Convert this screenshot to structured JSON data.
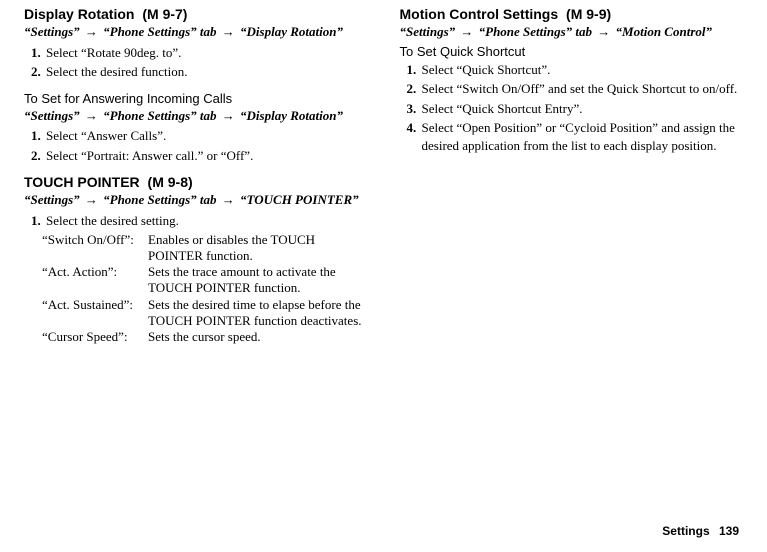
{
  "left": {
    "displayRotation": {
      "title": "Display Rotation",
      "mcode": "(M 9-7)",
      "navA": "“Settings”",
      "navB": "“Phone Settings” tab",
      "navC": "“Display Rotation”",
      "steps": [
        "Select “Rotate 90deg. to”.",
        "Select the desired function."
      ],
      "subhead": "To Set for Answering Incoming Calls",
      "stepsB": [
        "Select “Answer Calls”.",
        "Select “Portrait: Answer call.” or “Off”."
      ]
    },
    "touchPointer": {
      "title": "TOUCH POINTER",
      "mcode": "(M 9-8)",
      "navA": "“Settings”",
      "navB": "“Phone Settings” tab",
      "navC": "“TOUCH POINTER”",
      "step1": "Select the desired setting.",
      "defs": [
        {
          "term": "“Switch On/Off”:",
          "desc": "Enables or disables the TOUCH POINTER function."
        },
        {
          "term": "“Act. Action”:",
          "desc": "Sets the trace amount to activate the TOUCH POINTER function."
        },
        {
          "term": "“Act. Sustained”:",
          "desc": "Sets the desired time to elapse before the TOUCH POINTER function deactivates."
        },
        {
          "term": "“Cursor Speed”:",
          "desc": "Sets the cursor speed."
        }
      ]
    }
  },
  "right": {
    "motion": {
      "title": "Motion Control Settings",
      "mcode": "(M 9-9)",
      "navA": "“Settings”",
      "navB": "“Phone Settings” tab",
      "navC": "“Motion Control”",
      "subhead": "To Set Quick Shortcut",
      "steps": [
        "Select “Quick Shortcut”.",
        "Select “Switch On/Off” and set the Quick Shortcut to on/off.",
        "Select “Quick Shortcut Entry”.",
        "Select “Open Position” or “Cycloid Position” and assign the desired application from the list to each display position."
      ]
    }
  },
  "footer": {
    "label": "Settings",
    "page": "139"
  }
}
